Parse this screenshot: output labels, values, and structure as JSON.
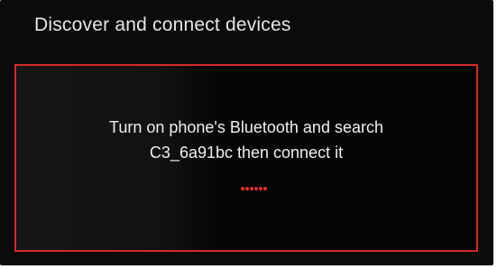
{
  "screen": {
    "title": "Discover and connect devices",
    "message_line1": "Turn on phone's Bluetooth and search",
    "message_line2": "C3_6a91bc then connect it"
  },
  "colors": {
    "background": "#0b0b0b",
    "accent_border": "#d42a2a",
    "text": "#e6e6e6",
    "spinner": "#e03030"
  },
  "icons": {
    "loading": "loading-dots-icon"
  }
}
